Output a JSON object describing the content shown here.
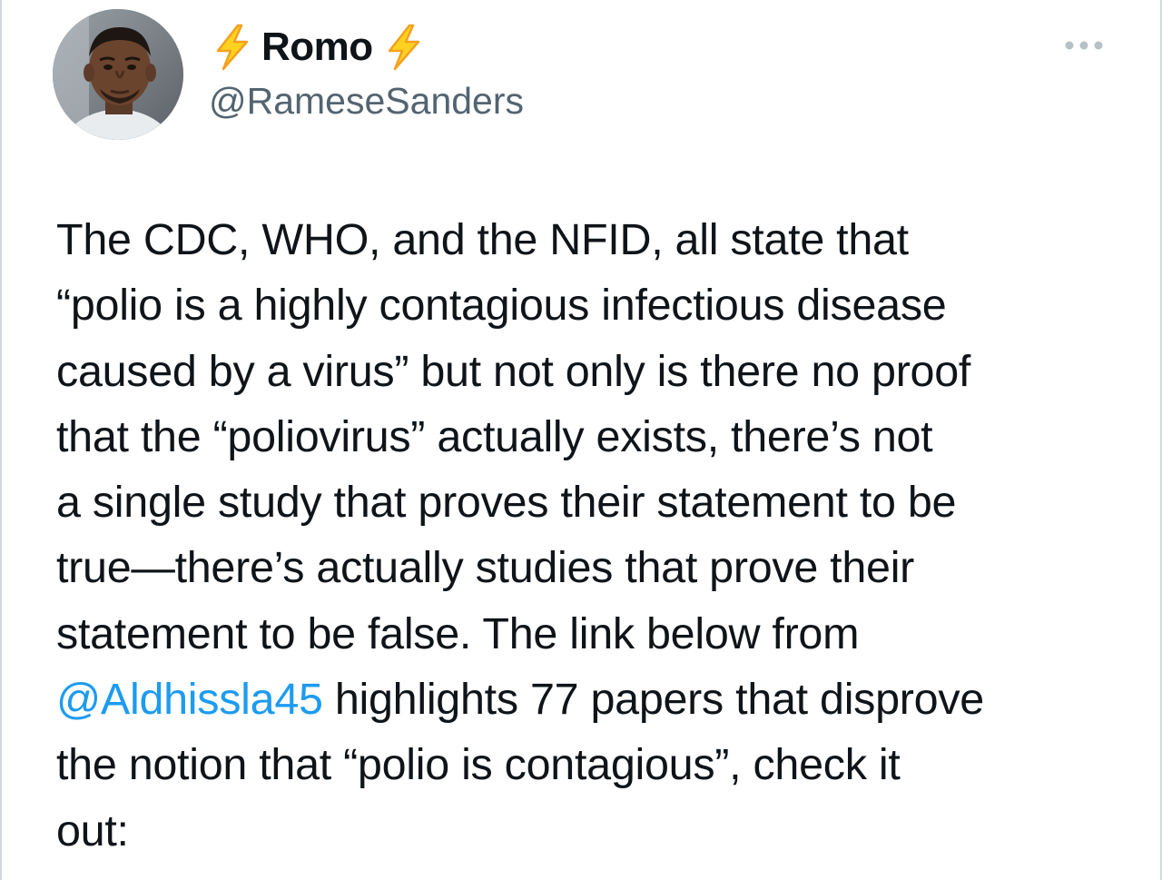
{
  "tweet": {
    "author": {
      "display_name": "Romo",
      "name_emoji_left": "lightning-bolt",
      "name_emoji_right": "lightning-bolt",
      "handle": "@RameseSanders",
      "avatar": "profile-photo"
    },
    "more_icon": "more-horizontal-icon",
    "body_lines": [
      {
        "text": "The CDC, WHO, and the NFID, all state that"
      },
      {
        "text": "“polio is a highly contagious infectious disease"
      },
      {
        "text": "caused by a virus” but not only is there no proof"
      },
      {
        "text": "that the “poliovirus” actually exists, there’s not"
      },
      {
        "text": "a single study that proves their statement to be"
      },
      {
        "text": "true—there’s actually studies that prove their"
      },
      {
        "text": "statement to be false. The link below from"
      },
      {
        "mention": "@Aldhissla45",
        "text": " highlights 77 papers that disprove"
      },
      {
        "text": "the notion that “polio is contagious”, check it"
      },
      {
        "text": "out:"
      }
    ]
  },
  "colors": {
    "text_primary": "#0f1419",
    "text_secondary": "#536471",
    "link": "#1d9bf0",
    "bolt_fill": "#ffd21f",
    "bolt_stroke": "#f4a020"
  }
}
